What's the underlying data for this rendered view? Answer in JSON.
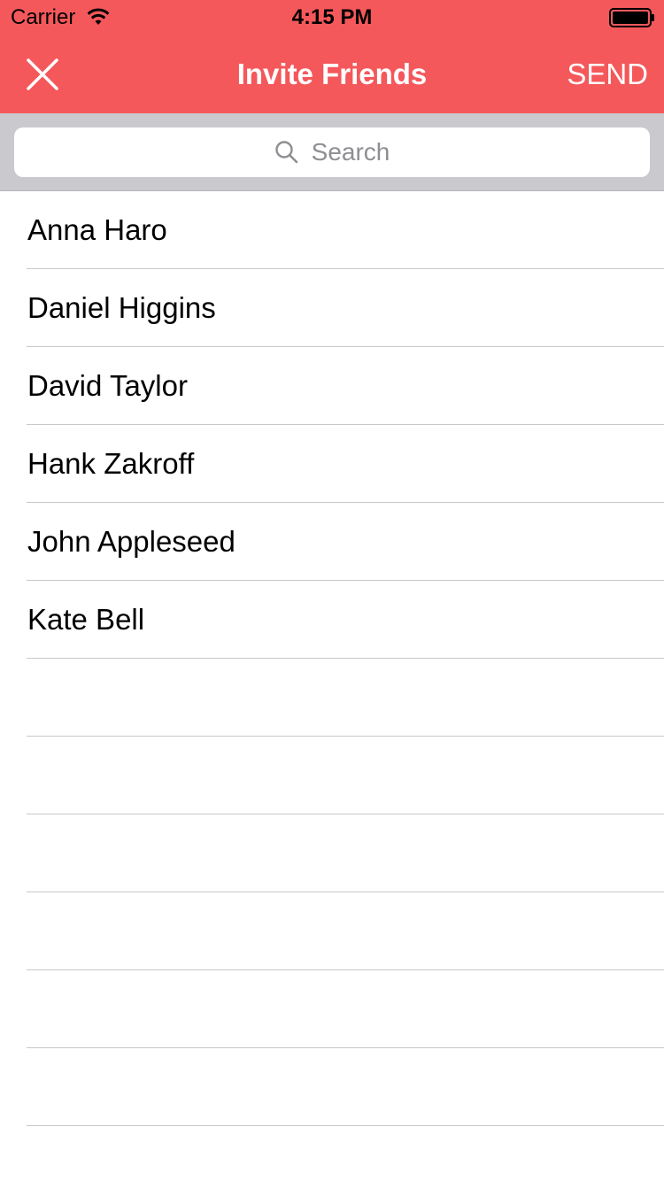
{
  "status_bar": {
    "carrier": "Carrier",
    "time": "4:15 PM",
    "wifi_icon": "wifi-icon",
    "battery_icon": "battery-icon"
  },
  "nav_bar": {
    "title": "Invite Friends",
    "close_icon": "close-icon",
    "send_label": "SEND",
    "background_color": "#f4585b"
  },
  "search": {
    "placeholder": "Search",
    "icon": "search-icon"
  },
  "contacts": [
    {
      "name": "Anna Haro"
    },
    {
      "name": "Daniel Higgins"
    },
    {
      "name": "David Taylor"
    },
    {
      "name": "Hank Zakroff"
    },
    {
      "name": "John Appleseed"
    },
    {
      "name": "Kate Bell"
    }
  ]
}
